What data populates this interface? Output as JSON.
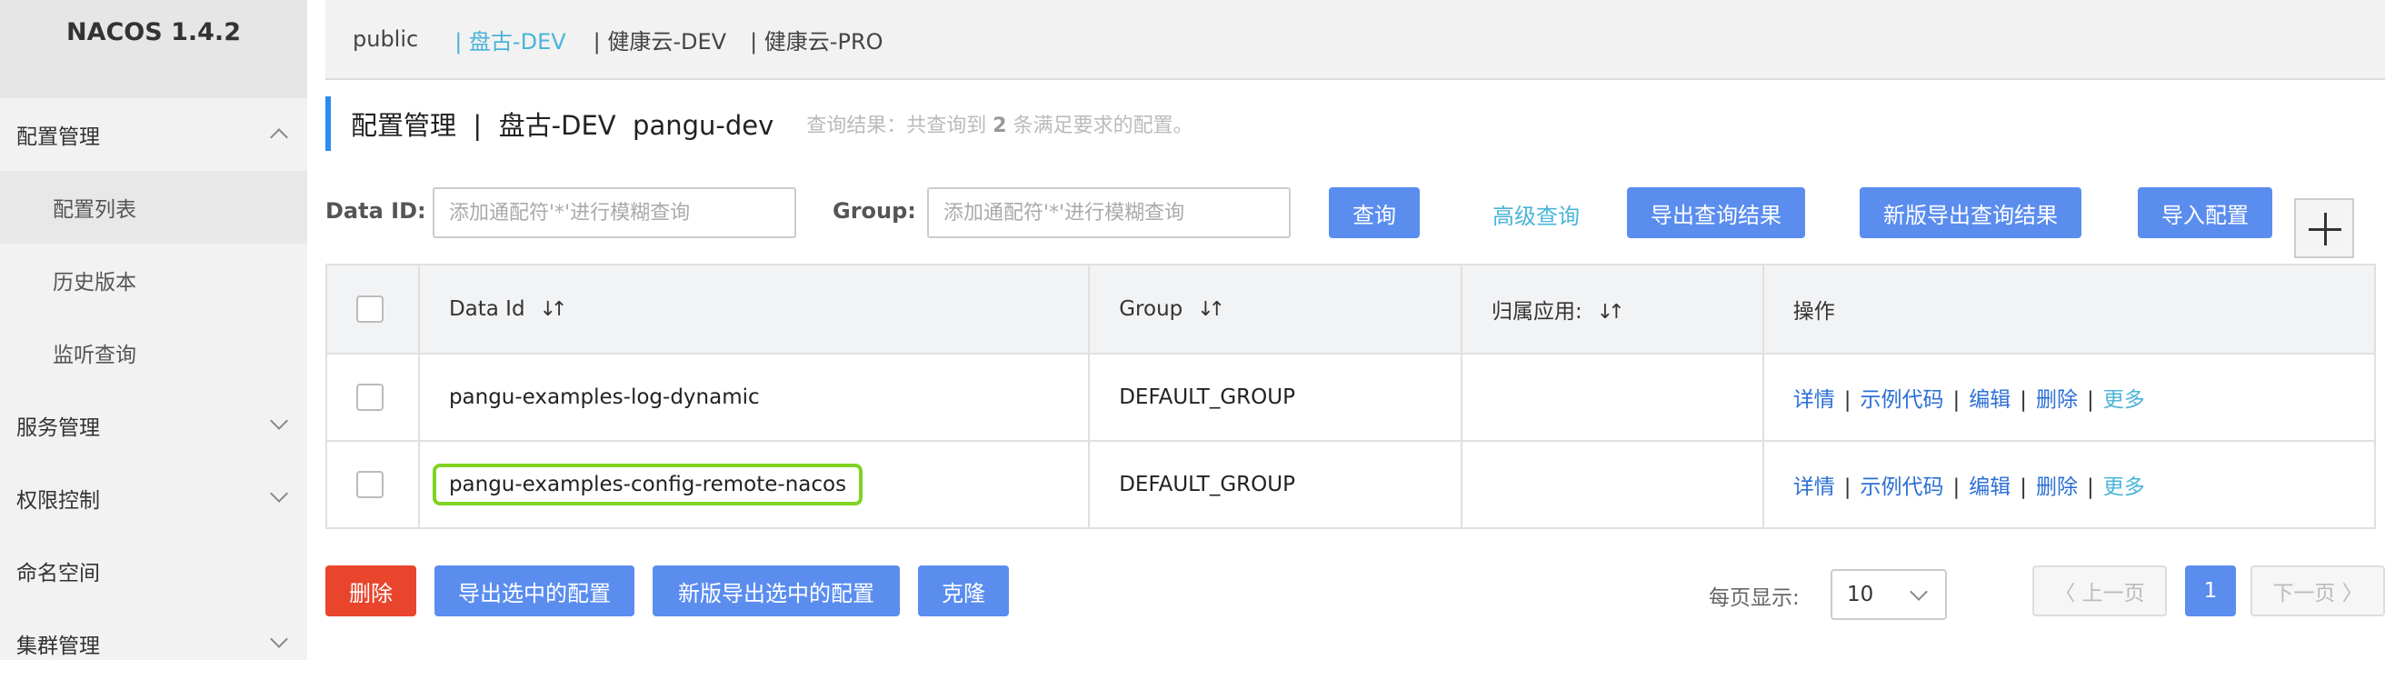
{
  "app": {
    "title": "NACOS 1.4.2"
  },
  "sidebar": {
    "items": [
      {
        "label": "配置管理",
        "expanded": true
      },
      {
        "label": "配置列表"
      },
      {
        "label": "历史版本"
      },
      {
        "label": "监听查询"
      },
      {
        "label": "服务管理"
      },
      {
        "label": "权限控制"
      },
      {
        "label": "命名空间"
      },
      {
        "label": "集群管理"
      }
    ]
  },
  "namespaces": [
    {
      "label": "public"
    },
    {
      "label": "| 盘古-DEV",
      "active": true
    },
    {
      "label": "| 健康云-DEV"
    },
    {
      "label": "| 健康云-PRO"
    }
  ],
  "header": {
    "title": "配置管理  |  盘古-DEV  pangu-dev",
    "result_prefix": "查询结果：共查询到 ",
    "result_count": "2",
    "result_suffix": " 条满足要求的配置。"
  },
  "filters": {
    "data_id_label": "Data ID:",
    "data_id_placeholder": "添加通配符'*'进行模糊查询",
    "group_label": "Group:",
    "group_placeholder": "添加通配符'*'进行模糊查询",
    "query_btn": "查询",
    "advanced_link": "高级查询",
    "export_btn": "导出查询结果",
    "new_export_btn": "新版导出查询结果",
    "import_btn": "导入配置"
  },
  "table": {
    "columns": [
      "Data Id",
      "Group",
      "归属应用:",
      "操作"
    ],
    "rows": [
      {
        "data_id": "pangu-examples-log-dynamic",
        "group": "DEFAULT_GROUP",
        "app": ""
      },
      {
        "data_id": "pangu-examples-config-remote-nacos",
        "group": "DEFAULT_GROUP",
        "app": ""
      }
    ],
    "ops": {
      "detail": "详情",
      "sample": "示例代码",
      "edit": "编辑",
      "delete": "删除",
      "more": "更多"
    }
  },
  "footer": {
    "delete_btn": "删除",
    "export_selected_btn": "导出选中的配置",
    "new_export_selected_btn": "新版导出选中的配置",
    "clone_btn": "克隆",
    "page_size_label": "每页显示:",
    "page_size": "10",
    "prev_btn": "〈 上一页",
    "current_page": "1",
    "next_btn": "下一页 〉"
  },
  "colors": {
    "primary": "#5b8def",
    "danger": "#e8452c",
    "link": "#2b6fd6",
    "active_tab": "#4ab4d8",
    "highlight": "#7ed321"
  }
}
